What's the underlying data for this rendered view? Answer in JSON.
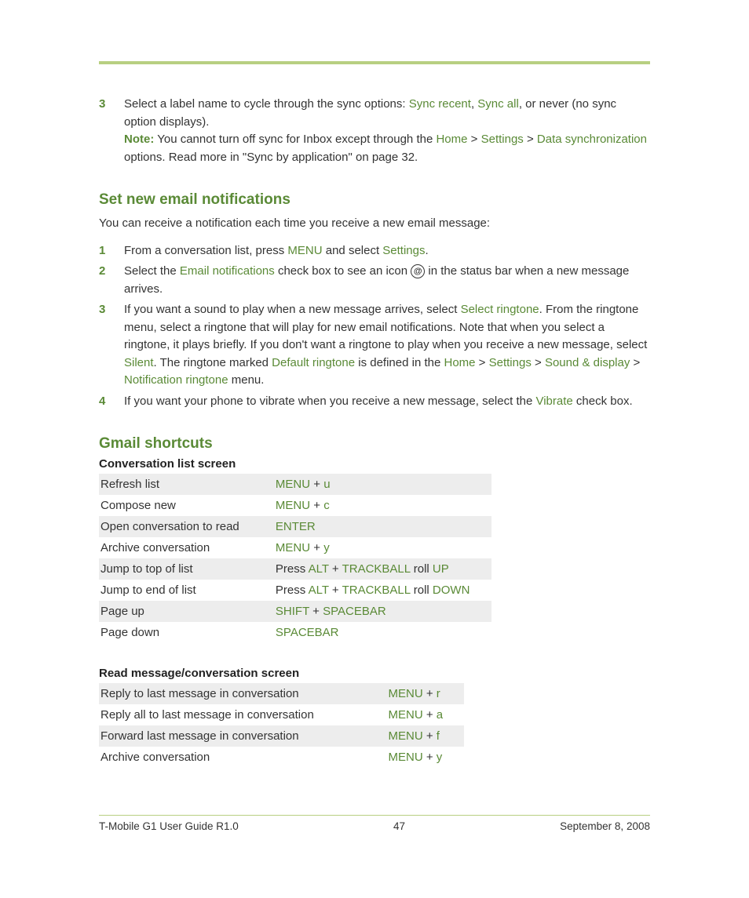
{
  "step3a": {
    "num": "3",
    "t1": "Select a label name to cycle through the sync options: ",
    "k1": "Sync recent",
    "t2": ", ",
    "k2": "Sync all",
    "t3": ", or never (no sync option displays).",
    "noteLabel": "Note:",
    "n1": " You cannot turn off sync for Inbox except through the ",
    "nk1": "Home",
    "n2": " > ",
    "nk2": "Settings",
    "n3": " > ",
    "nk3": "Data synchronization",
    "n4": " options. Read more in \"Sync by application\" on page 32."
  },
  "sec1": {
    "heading": "Set new email notifications",
    "lead": "You can receive a notification each time you receive a new email message:"
  },
  "s1": {
    "num": "1",
    "t1": "From a conversation list, press ",
    "k1": "MENU",
    "t2": " and select ",
    "k2": "Settings",
    "t3": "."
  },
  "s2": {
    "num": "2",
    "t1": "Select the ",
    "k1": "Email notifications",
    "t2": " check box to see an icon ",
    "t3": " in the status bar when a new message arrives."
  },
  "s3": {
    "num": "3",
    "t1": "If you want a sound to play when a new message arrives, select ",
    "k1": "Select ringtone",
    "t2": ". From the ringtone menu, select a ringtone that will play for new email notifications. Note that when you select a ringtone, it plays briefly. If you don't want a ringtone to play when you receive a new message, select ",
    "k2": "Silent",
    "t3": ". The ringtone marked ",
    "k3": "Default ringtone",
    "t4": " is defined in the ",
    "k4": "Home",
    "t5": " > ",
    "k5": "Settings",
    "t6": " > ",
    "k6": "Sound & display",
    "t7": " > ",
    "k7": "Notification ringtone",
    "t8": " menu."
  },
  "s4": {
    "num": "4",
    "t1": "If you want your phone to vibrate when you receive a new message, select the ",
    "k1": "Vibrate",
    "t2": " check box."
  },
  "sec2": {
    "heading": "Gmail shortcuts"
  },
  "t1": {
    "caption": "Conversation list screen",
    "r1": {
      "a": "Refresh list",
      "p1": "MENU",
      "p2": " + ",
      "p3": "u"
    },
    "r2": {
      "a": "Compose new",
      "p1": "MENU",
      "p2": " + ",
      "p3": "c"
    },
    "r3": {
      "a": "Open conversation to read",
      "p1": "ENTER"
    },
    "r4": {
      "a": "Archive conversation",
      "p1": "MENU",
      "p2": " + ",
      "p3": "y"
    },
    "r5": {
      "a": "Jump to top of list",
      "p0": "Press ",
      "p1": "ALT",
      "p2": " + ",
      "p3": "TRACKBALL",
      "p4": " roll ",
      "p5": "UP"
    },
    "r6": {
      "a": "Jump to end of list",
      "p0": "Press ",
      "p1": "ALT",
      "p2": " + ",
      "p3": "TRACKBALL",
      "p4": " roll ",
      "p5": "DOWN"
    },
    "r7": {
      "a": "Page up",
      "p1": "SHIFT",
      "p2": " + ",
      "p3": "SPACEBAR"
    },
    "r8": {
      "a": "Page down",
      "p1": "SPACEBAR"
    }
  },
  "t2": {
    "caption": "Read message/conversation screen",
    "r1": {
      "a": "Reply to last message in conversation",
      "p1": "MENU",
      "p2": " + ",
      "p3": "r"
    },
    "r2": {
      "a": "Reply all to last message in conversation",
      "p1": "MENU",
      "p2": " + ",
      "p3": "a"
    },
    "r3": {
      "a": "Forward last message in conversation",
      "p1": "MENU",
      "p2": " + ",
      "p3": "f"
    },
    "r4": {
      "a": "Archive conversation",
      "p1": "MENU",
      "p2": " + ",
      "p3": "y"
    }
  },
  "footer": {
    "left": "T-Mobile G1 User Guide R1.0",
    "center": "47",
    "right": "September 8, 2008"
  },
  "atGlyph": "@"
}
